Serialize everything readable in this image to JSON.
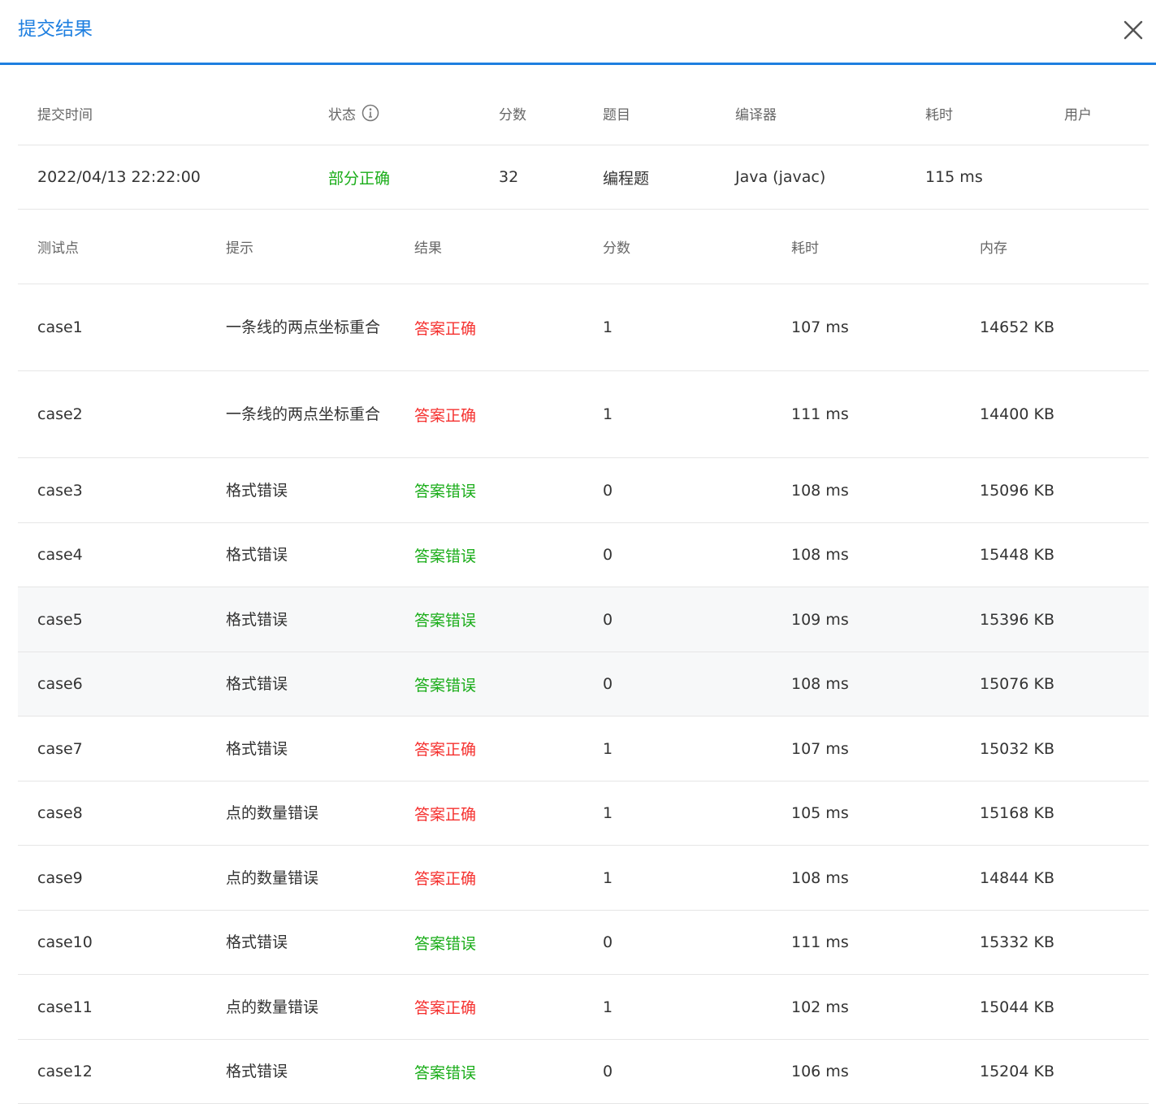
{
  "dialog": {
    "title": "提交结果",
    "close_icon": "close-icon"
  },
  "summary": {
    "headers": {
      "time": "提交时间",
      "status": "状态",
      "score": "分数",
      "problem": "题目",
      "compiler": "编译器",
      "duration": "耗时",
      "user": "用户"
    },
    "row": {
      "time": "2022/04/13 22:22:00",
      "status": "部分正确",
      "score": "32",
      "problem": "编程题",
      "compiler": "Java (javac)",
      "duration": "115 ms",
      "user": ""
    }
  },
  "cases": {
    "headers": {
      "point": "测试点",
      "hint": "提示",
      "result": "结果",
      "score": "分数",
      "duration": "耗时",
      "memory": "内存"
    },
    "rows": [
      {
        "point": "case1",
        "hint": "一条线的两点坐标重合",
        "result": "答案正确",
        "score": "1",
        "duration": "107 ms",
        "memory": "14652 KB"
      },
      {
        "point": "case2",
        "hint": "一条线的两点坐标重合",
        "result": "答案正确",
        "score": "1",
        "duration": "111 ms",
        "memory": "14400 KB"
      },
      {
        "point": "case3",
        "hint": "格式错误",
        "result": "答案错误",
        "score": "0",
        "duration": "108 ms",
        "memory": "15096 KB"
      },
      {
        "point": "case4",
        "hint": "格式错误",
        "result": "答案错误",
        "score": "0",
        "duration": "108 ms",
        "memory": "15448 KB"
      },
      {
        "point": "case5",
        "hint": "格式错误",
        "result": "答案错误",
        "score": "0",
        "duration": "109 ms",
        "memory": "15396 KB"
      },
      {
        "point": "case6",
        "hint": "格式错误",
        "result": "答案错误",
        "score": "0",
        "duration": "108 ms",
        "memory": "15076 KB"
      },
      {
        "point": "case7",
        "hint": "格式错误",
        "result": "答案正确",
        "score": "1",
        "duration": "107 ms",
        "memory": "15032 KB"
      },
      {
        "point": "case8",
        "hint": "点的数量错误",
        "result": "答案正确",
        "score": "1",
        "duration": "105 ms",
        "memory": "15168 KB"
      },
      {
        "point": "case9",
        "hint": "点的数量错误",
        "result": "答案正确",
        "score": "1",
        "duration": "108 ms",
        "memory": "14844 KB"
      },
      {
        "point": "case10",
        "hint": "格式错误",
        "result": "答案错误",
        "score": "0",
        "duration": "111 ms",
        "memory": "15332 KB"
      },
      {
        "point": "case11",
        "hint": "点的数量错误",
        "result": "答案正确",
        "score": "1",
        "duration": "102 ms",
        "memory": "15044 KB"
      },
      {
        "point": "case12",
        "hint": "格式错误",
        "result": "答案错误",
        "score": "0",
        "duration": "106 ms",
        "memory": "15204 KB"
      }
    ]
  },
  "colors": {
    "accent": "#1e7fe0",
    "correct": "#f5312f",
    "wrong": "#1aad19",
    "partial": "#1aad19"
  }
}
